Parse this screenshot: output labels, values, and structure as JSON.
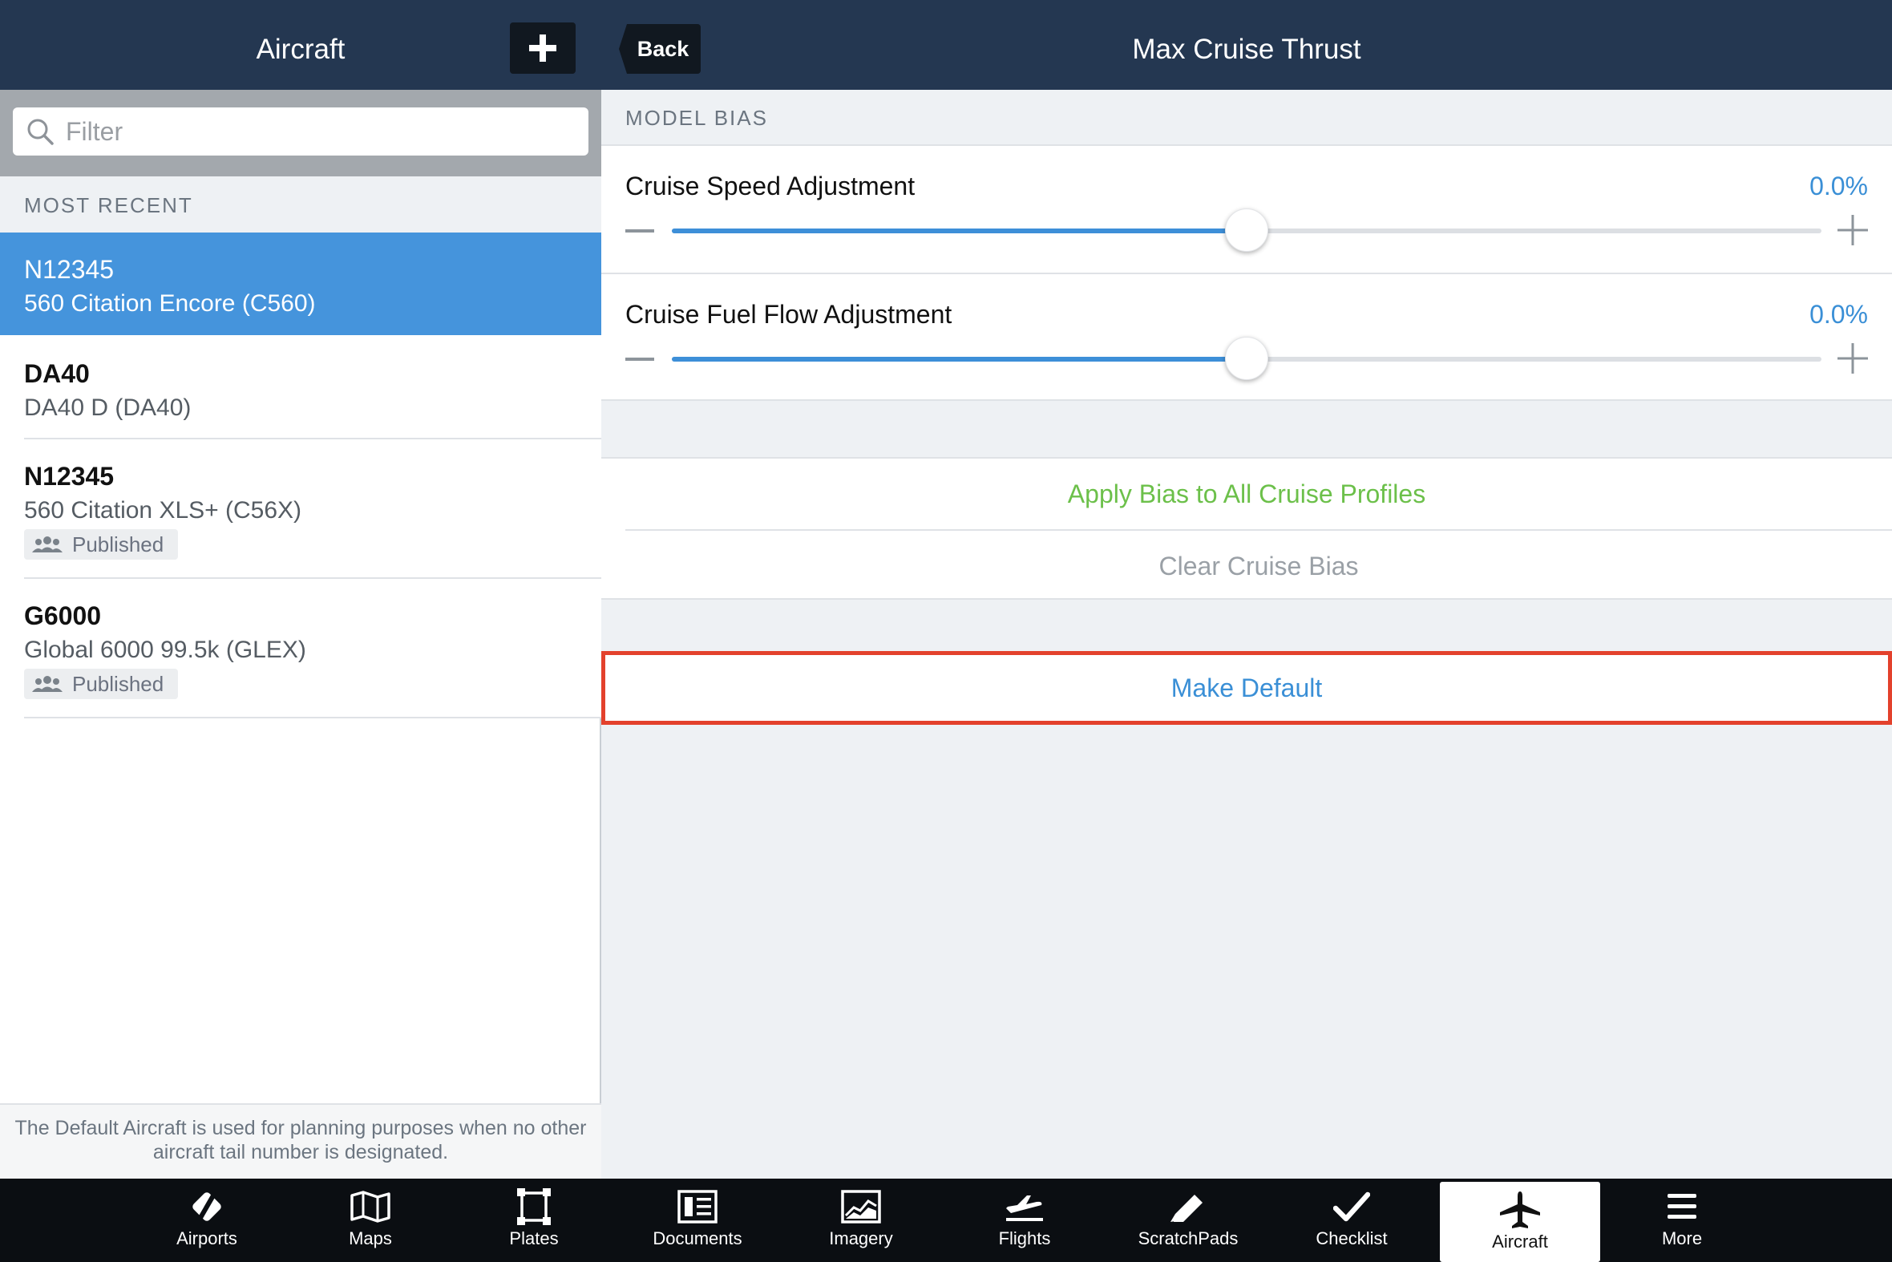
{
  "left": {
    "title": "Aircraft",
    "search_placeholder": "Filter",
    "section": "MOST RECENT",
    "items": [
      {
        "title": "N12345",
        "subtitle": "560 Citation Encore (C560)"
      },
      {
        "title": "DA40",
        "subtitle": "DA40 D (DA40)"
      },
      {
        "title": "N12345",
        "subtitle": "560 Citation XLS+ (C56X)",
        "badge": "Published"
      },
      {
        "title": "G6000",
        "subtitle": "Global 6000 99.5k (GLEX)",
        "badge": "Published"
      }
    ],
    "footer": "The Default Aircraft is used for planning purposes when no other aircraft tail number is designated."
  },
  "right": {
    "back_label": "Back",
    "title": "Max Cruise Thrust",
    "section": "MODEL BIAS",
    "sliders": [
      {
        "label": "Cruise Speed Adjustment",
        "value": "0.0%",
        "position": 0.5
      },
      {
        "label": "Cruise Fuel Flow Adjustment",
        "value": "0.0%",
        "position": 0.5
      }
    ],
    "apply_label": "Apply Bias to All Cruise Profiles",
    "clear_label": "Clear Cruise Bias",
    "make_default_label": "Make Default"
  },
  "tabs": [
    {
      "label": "Airports",
      "icon": "airports-icon"
    },
    {
      "label": "Maps",
      "icon": "maps-icon"
    },
    {
      "label": "Plates",
      "icon": "plates-icon"
    },
    {
      "label": "Documents",
      "icon": "documents-icon"
    },
    {
      "label": "Imagery",
      "icon": "imagery-icon"
    },
    {
      "label": "Flights",
      "icon": "flights-icon"
    },
    {
      "label": "ScratchPads",
      "icon": "scratchpads-icon"
    },
    {
      "label": "Checklist",
      "icon": "checklist-icon"
    },
    {
      "label": "Aircraft",
      "icon": "aircraft-icon",
      "active": true
    },
    {
      "label": "More",
      "icon": "more-icon"
    }
  ],
  "colors": {
    "header": "#243751",
    "selected_row": "#4594dc",
    "accent_blue": "#3a8fd6",
    "apply_green": "#6cc04a",
    "highlight_red": "#e3412c",
    "tabbar": "#0b0e12"
  }
}
